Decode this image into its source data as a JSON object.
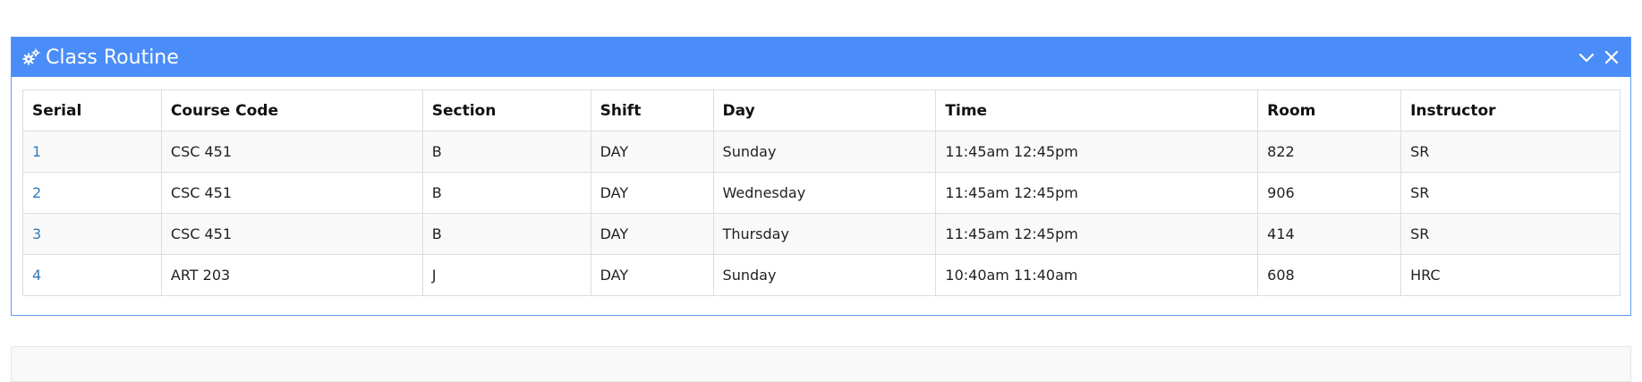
{
  "panel": {
    "title": "Class Routine",
    "accent_color": "#4b8df8",
    "icons": {
      "title_icon": "gears-icon",
      "collapse": "chevron-down-icon",
      "close": "close-icon"
    }
  },
  "table": {
    "headers": [
      "Serial",
      "Course Code",
      "Section",
      "Shift",
      "Day",
      "Time",
      "Room",
      "Instructor"
    ],
    "rows": [
      {
        "serial": "1",
        "course_code": "CSC 451",
        "section": "B",
        "shift": "DAY",
        "day": "Sunday",
        "time": "11:45am 12:45pm",
        "room": "822",
        "instructor": "SR"
      },
      {
        "serial": "2",
        "course_code": "CSC 451",
        "section": "B",
        "shift": "DAY",
        "day": "Wednesday",
        "time": "11:45am 12:45pm",
        "room": "906",
        "instructor": "SR"
      },
      {
        "serial": "3",
        "course_code": "CSC 451",
        "section": "B",
        "shift": "DAY",
        "day": "Thursday",
        "time": "11:45am 12:45pm",
        "room": "414",
        "instructor": "SR"
      },
      {
        "serial": "4",
        "course_code": "ART 203",
        "section": "J",
        "shift": "DAY",
        "day": "Sunday",
        "time": "10:40am 11:40am",
        "room": "608",
        "instructor": "HRC"
      }
    ]
  }
}
